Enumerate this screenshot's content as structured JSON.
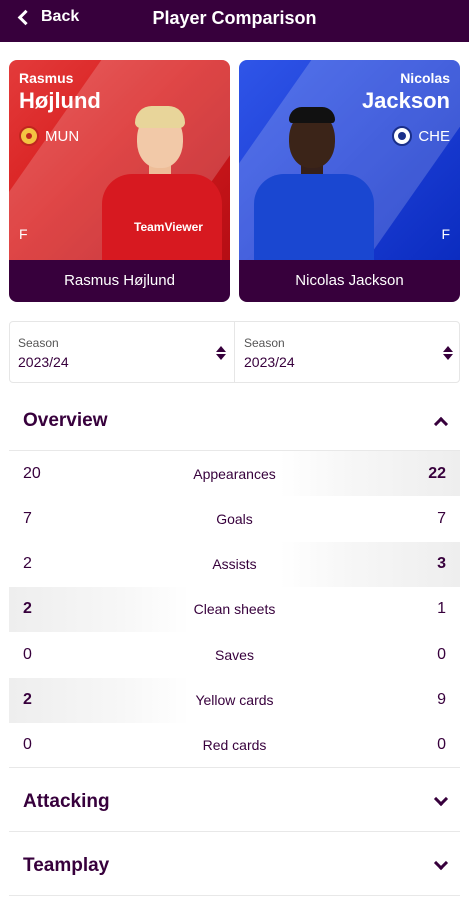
{
  "header": {
    "back_label": "Back",
    "title": "Player Comparison"
  },
  "players": [
    {
      "first_name": "Rasmus",
      "last_name": "Højlund",
      "club": "MUN",
      "position": "F",
      "full_name": "Rasmus Højlund",
      "club_icon": "manchester-united-crest"
    },
    {
      "first_name": "Nicolas",
      "last_name": "Jackson",
      "club": "CHE",
      "position": "F",
      "full_name": "Nicolas Jackson",
      "club_icon": "chelsea-crest"
    }
  ],
  "seasons": [
    {
      "label": "Season",
      "value": "2023/24"
    },
    {
      "label": "Season",
      "value": "2023/24"
    }
  ],
  "sections": {
    "overview": "Overview",
    "attacking": "Attacking",
    "teamplay": "Teamplay"
  },
  "stats": [
    {
      "name": "Appearances",
      "left": "20",
      "right": "22",
      "winner": "right"
    },
    {
      "name": "Goals",
      "left": "7",
      "right": "7",
      "winner": "none"
    },
    {
      "name": "Assists",
      "left": "2",
      "right": "3",
      "winner": "right"
    },
    {
      "name": "Clean sheets",
      "left": "2",
      "right": "1",
      "winner": "left"
    },
    {
      "name": "Saves",
      "left": "0",
      "right": "0",
      "winner": "none"
    },
    {
      "name": "Yellow cards",
      "left": "2",
      "right": "9",
      "winner": "left"
    },
    {
      "name": "Red cards",
      "left": "0",
      "right": "0",
      "winner": "none"
    }
  ],
  "colors": {
    "brand": "#37003c",
    "mun_red": "#d81e1e",
    "che_blue": "#1d3fd6"
  }
}
